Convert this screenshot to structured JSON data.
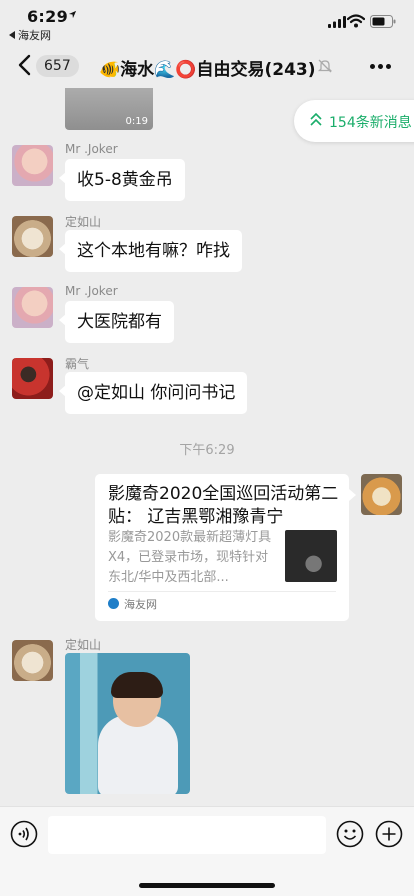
{
  "status_bar": {
    "time": "6:29",
    "back_app": "海友网",
    "icons": [
      "location-arrow-icon",
      "cellular-signal-icon",
      "wifi-icon",
      "battery-icon"
    ]
  },
  "nav": {
    "unread_count": "657",
    "title": "🐠海水🌊⭕自由交易(243)",
    "icons": [
      "back-chevron-icon",
      "mute-bell-icon",
      "more-dots-icon"
    ]
  },
  "chat": {
    "video_duration": "0:19",
    "new_messages_label": "154条新消息",
    "messages": [
      {
        "sender": "Mr .Joker",
        "text": "收5-8黄金吊"
      },
      {
        "sender": "定如山",
        "text": "这个本地有嘛？咋找"
      },
      {
        "sender": "Mr .Joker",
        "text": "大医院都有"
      },
      {
        "sender": "霸气",
        "text": "@定如山 你问问书记"
      }
    ],
    "time_separator": "下午6:29",
    "link_card": {
      "title": "影魔奇2020全国巡回活动第二贴：  辽吉黑鄂湘豫青宁",
      "description": "影魔奇2020款最新超薄灯具X4，已登录市场，现特针对东北/华中及西北部...",
      "source": "海友网"
    },
    "last_sender": "定如山"
  },
  "input_bar": {
    "icons": [
      "voice-icon",
      "emoji-icon",
      "plus-icon"
    ]
  },
  "colors": {
    "accent_green": "#1aad6a",
    "background": "#ededed",
    "bubble": "#ffffff"
  }
}
